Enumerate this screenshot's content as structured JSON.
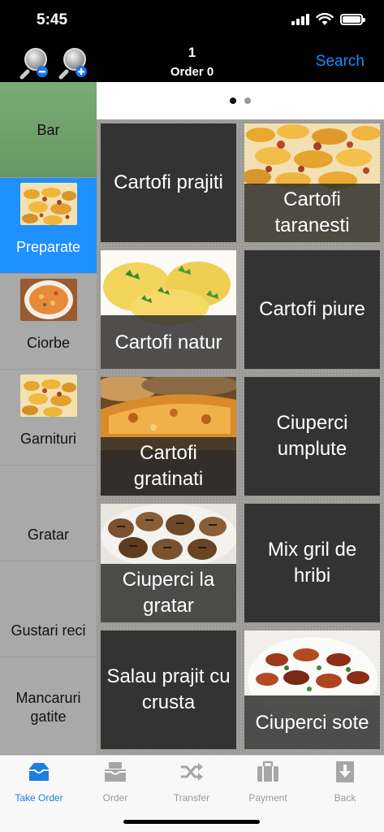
{
  "status": {
    "time": "5:45"
  },
  "nav": {
    "order_count": "1",
    "order_label": "Order 0",
    "search_label": "Search"
  },
  "categories": [
    {
      "label": "Bar"
    },
    {
      "label": "Preparate"
    },
    {
      "label": "Ciorbe"
    },
    {
      "label": "Garnituri"
    },
    {
      "label": "Gratar"
    },
    {
      "label": "Gustari reci"
    },
    {
      "label": "Mancaruri gatite"
    }
  ],
  "pager": {
    "pages": 2,
    "current": 1
  },
  "items": [
    {
      "label": "Cartofi prajiti",
      "image": "none"
    },
    {
      "label": "Cartofi taranesti",
      "image": "potato-wedges-photo"
    },
    {
      "label": "Cartofi natur",
      "image": "boiled-potatoes-photo"
    },
    {
      "label": "Cartofi piure",
      "image": "none"
    },
    {
      "label": "Cartofi gratinati",
      "image": "gratin-photo"
    },
    {
      "label": "Ciuperci umplute",
      "image": "none"
    },
    {
      "label": "Ciuperci la gratar",
      "image": "grilled-mushrooms-photo"
    },
    {
      "label": "Mix gril de hribi",
      "image": "none"
    },
    {
      "label": "Salau prajit cu crusta",
      "image": "none"
    },
    {
      "label": "Ciuperci sote",
      "image": "sauteed-mushrooms-photo"
    }
  ],
  "tabs": [
    {
      "label": "Take Order",
      "icon": "inbox-icon"
    },
    {
      "label": "Order",
      "icon": "tray-icon"
    },
    {
      "label": "Transfer",
      "icon": "shuffle-icon"
    },
    {
      "label": "Payment",
      "icon": "briefcase-icon"
    },
    {
      "label": "Back",
      "icon": "download-icon"
    }
  ],
  "colors": {
    "accent": "#1a8cff",
    "active_category": "#1e90ff",
    "bar_category": "#6f9f6a",
    "tile": "#333333"
  }
}
